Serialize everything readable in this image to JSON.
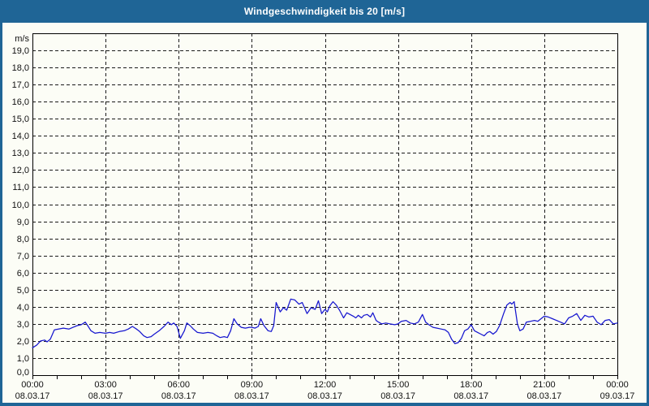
{
  "window": {
    "title": "Windgeschwindigkeit bis 20 [m/s]"
  },
  "colors": {
    "titlebar_bg": "#1f6596",
    "frame": "#1f6596",
    "background": "#fcfdf6",
    "title_text": "#ffffff",
    "plot_border": "#000000",
    "gridline": "#1a1a1a",
    "tick": "#000000",
    "label": "#111111",
    "line": "#1616cf"
  },
  "chart_data": {
    "type": "line",
    "title": "Windgeschwindigkeit bis 20 [m/s]",
    "ylabel_unit": "m/s",
    "ylim": [
      0,
      20
    ],
    "y_tick_step": 1,
    "y_tick_labels": [
      "0,0",
      "1,0",
      "2,0",
      "3,0",
      "4,0",
      "5,0",
      "6,0",
      "7,0",
      "8,0",
      "9,0",
      "10,0",
      "11,0",
      "12,0",
      "13,0",
      "14,0",
      "15,0",
      "16,0",
      "17,0",
      "18,0",
      "19,0"
    ],
    "grid": {
      "horizontal_dashed": true,
      "vertical_dashed_every_minutes": 180
    },
    "x_range_minutes": [
      0,
      1440
    ],
    "x_minor_tick_minutes": 60,
    "x_major_ticks": [
      {
        "minutes": 0,
        "time": "00:00",
        "date": "08.03.17"
      },
      {
        "minutes": 180,
        "time": "03:00",
        "date": "08.03.17"
      },
      {
        "minutes": 360,
        "time": "06:00",
        "date": "08.03.17"
      },
      {
        "minutes": 540,
        "time": "09:00",
        "date": "08.03.17"
      },
      {
        "minutes": 720,
        "time": "12:00",
        "date": "08.03.17"
      },
      {
        "minutes": 900,
        "time": "15:00",
        "date": "08.03.17"
      },
      {
        "minutes": 1080,
        "time": "18:00",
        "date": "08.03.17"
      },
      {
        "minutes": 1260,
        "time": "21:00",
        "date": "08.03.17"
      },
      {
        "minutes": 1440,
        "time": "00:00",
        "date": "09.03.17"
      }
    ],
    "series": [
      {
        "name": "Windgeschwindigkeit",
        "unit": "m/s",
        "color": "#1616cf",
        "points_min_value": [
          [
            0,
            1.6
          ],
          [
            10,
            1.75
          ],
          [
            20,
            2.0
          ],
          [
            30,
            2.05
          ],
          [
            36,
            1.95
          ],
          [
            44,
            2.1
          ],
          [
            54,
            2.65
          ],
          [
            64,
            2.7
          ],
          [
            76,
            2.75
          ],
          [
            90,
            2.7
          ],
          [
            100,
            2.8
          ],
          [
            110,
            2.9
          ],
          [
            120,
            2.95
          ],
          [
            130,
            3.1
          ],
          [
            136,
            2.9
          ],
          [
            144,
            2.6
          ],
          [
            154,
            2.45
          ],
          [
            166,
            2.5
          ],
          [
            180,
            2.45
          ],
          [
            190,
            2.5
          ],
          [
            200,
            2.45
          ],
          [
            214,
            2.55
          ],
          [
            226,
            2.6
          ],
          [
            236,
            2.7
          ],
          [
            246,
            2.85
          ],
          [
            256,
            2.7
          ],
          [
            264,
            2.55
          ],
          [
            274,
            2.3
          ],
          [
            282,
            2.2
          ],
          [
            292,
            2.25
          ],
          [
            300,
            2.4
          ],
          [
            312,
            2.6
          ],
          [
            324,
            2.85
          ],
          [
            334,
            3.1
          ],
          [
            342,
            2.95
          ],
          [
            348,
            3.05
          ],
          [
            356,
            2.85
          ],
          [
            364,
            2.15
          ],
          [
            374,
            2.6
          ],
          [
            380,
            3.05
          ],
          [
            388,
            2.9
          ],
          [
            396,
            2.7
          ],
          [
            406,
            2.5
          ],
          [
            420,
            2.45
          ],
          [
            432,
            2.5
          ],
          [
            444,
            2.45
          ],
          [
            454,
            2.3
          ],
          [
            462,
            2.2
          ],
          [
            472,
            2.25
          ],
          [
            480,
            2.2
          ],
          [
            488,
            2.6
          ],
          [
            496,
            3.3
          ],
          [
            504,
            3.0
          ],
          [
            514,
            2.8
          ],
          [
            524,
            2.75
          ],
          [
            534,
            2.8
          ],
          [
            540,
            2.8
          ],
          [
            548,
            2.75
          ],
          [
            556,
            2.85
          ],
          [
            562,
            3.3
          ],
          [
            570,
            2.9
          ],
          [
            580,
            2.6
          ],
          [
            588,
            2.55
          ],
          [
            594,
            2.9
          ],
          [
            600,
            4.25
          ],
          [
            610,
            3.7
          ],
          [
            618,
            3.95
          ],
          [
            626,
            3.8
          ],
          [
            636,
            4.45
          ],
          [
            646,
            4.4
          ],
          [
            656,
            4.15
          ],
          [
            664,
            4.25
          ],
          [
            676,
            3.6
          ],
          [
            686,
            3.95
          ],
          [
            696,
            3.85
          ],
          [
            704,
            4.35
          ],
          [
            712,
            3.6
          ],
          [
            720,
            3.85
          ],
          [
            726,
            3.7
          ],
          [
            732,
            4.05
          ],
          [
            740,
            4.3
          ],
          [
            748,
            4.1
          ],
          [
            756,
            3.8
          ],
          [
            766,
            3.35
          ],
          [
            774,
            3.65
          ],
          [
            782,
            3.55
          ],
          [
            790,
            3.45
          ],
          [
            796,
            3.35
          ],
          [
            802,
            3.5
          ],
          [
            810,
            3.35
          ],
          [
            816,
            3.5
          ],
          [
            824,
            3.55
          ],
          [
            832,
            3.4
          ],
          [
            838,
            3.65
          ],
          [
            846,
            3.2
          ],
          [
            852,
            3.1
          ],
          [
            860,
            3.0
          ],
          [
            870,
            3.05
          ],
          [
            880,
            3.0
          ],
          [
            892,
            2.95
          ],
          [
            900,
            3.0
          ],
          [
            908,
            3.15
          ],
          [
            920,
            3.2
          ],
          [
            930,
            3.05
          ],
          [
            940,
            3.0
          ],
          [
            950,
            3.1
          ],
          [
            960,
            3.55
          ],
          [
            968,
            3.1
          ],
          [
            976,
            2.95
          ],
          [
            986,
            2.8
          ],
          [
            996,
            2.75
          ],
          [
            1006,
            2.7
          ],
          [
            1016,
            2.65
          ],
          [
            1024,
            2.5
          ],
          [
            1032,
            2.1
          ],
          [
            1040,
            1.85
          ],
          [
            1048,
            1.9
          ],
          [
            1056,
            2.15
          ],
          [
            1064,
            2.6
          ],
          [
            1072,
            2.7
          ],
          [
            1080,
            2.95
          ],
          [
            1088,
            2.6
          ],
          [
            1096,
            2.5
          ],
          [
            1104,
            2.4
          ],
          [
            1112,
            2.3
          ],
          [
            1120,
            2.5
          ],
          [
            1126,
            2.55
          ],
          [
            1134,
            2.4
          ],
          [
            1142,
            2.55
          ],
          [
            1150,
            2.9
          ],
          [
            1160,
            3.6
          ],
          [
            1168,
            4.1
          ],
          [
            1176,
            4.25
          ],
          [
            1180,
            4.15
          ],
          [
            1186,
            4.3
          ],
          [
            1194,
            3.0
          ],
          [
            1200,
            2.6
          ],
          [
            1208,
            2.7
          ],
          [
            1216,
            3.1
          ],
          [
            1226,
            3.15
          ],
          [
            1236,
            3.2
          ],
          [
            1244,
            3.15
          ],
          [
            1252,
            3.3
          ],
          [
            1260,
            3.45
          ],
          [
            1270,
            3.4
          ],
          [
            1280,
            3.3
          ],
          [
            1290,
            3.2
          ],
          [
            1300,
            3.1
          ],
          [
            1310,
            3.0
          ],
          [
            1320,
            3.35
          ],
          [
            1330,
            3.45
          ],
          [
            1340,
            3.6
          ],
          [
            1350,
            3.2
          ],
          [
            1360,
            3.5
          ],
          [
            1370,
            3.4
          ],
          [
            1380,
            3.45
          ],
          [
            1390,
            3.1
          ],
          [
            1400,
            2.95
          ],
          [
            1410,
            3.2
          ],
          [
            1420,
            3.25
          ],
          [
            1430,
            3.0
          ],
          [
            1440,
            3.05
          ]
        ]
      }
    ]
  }
}
